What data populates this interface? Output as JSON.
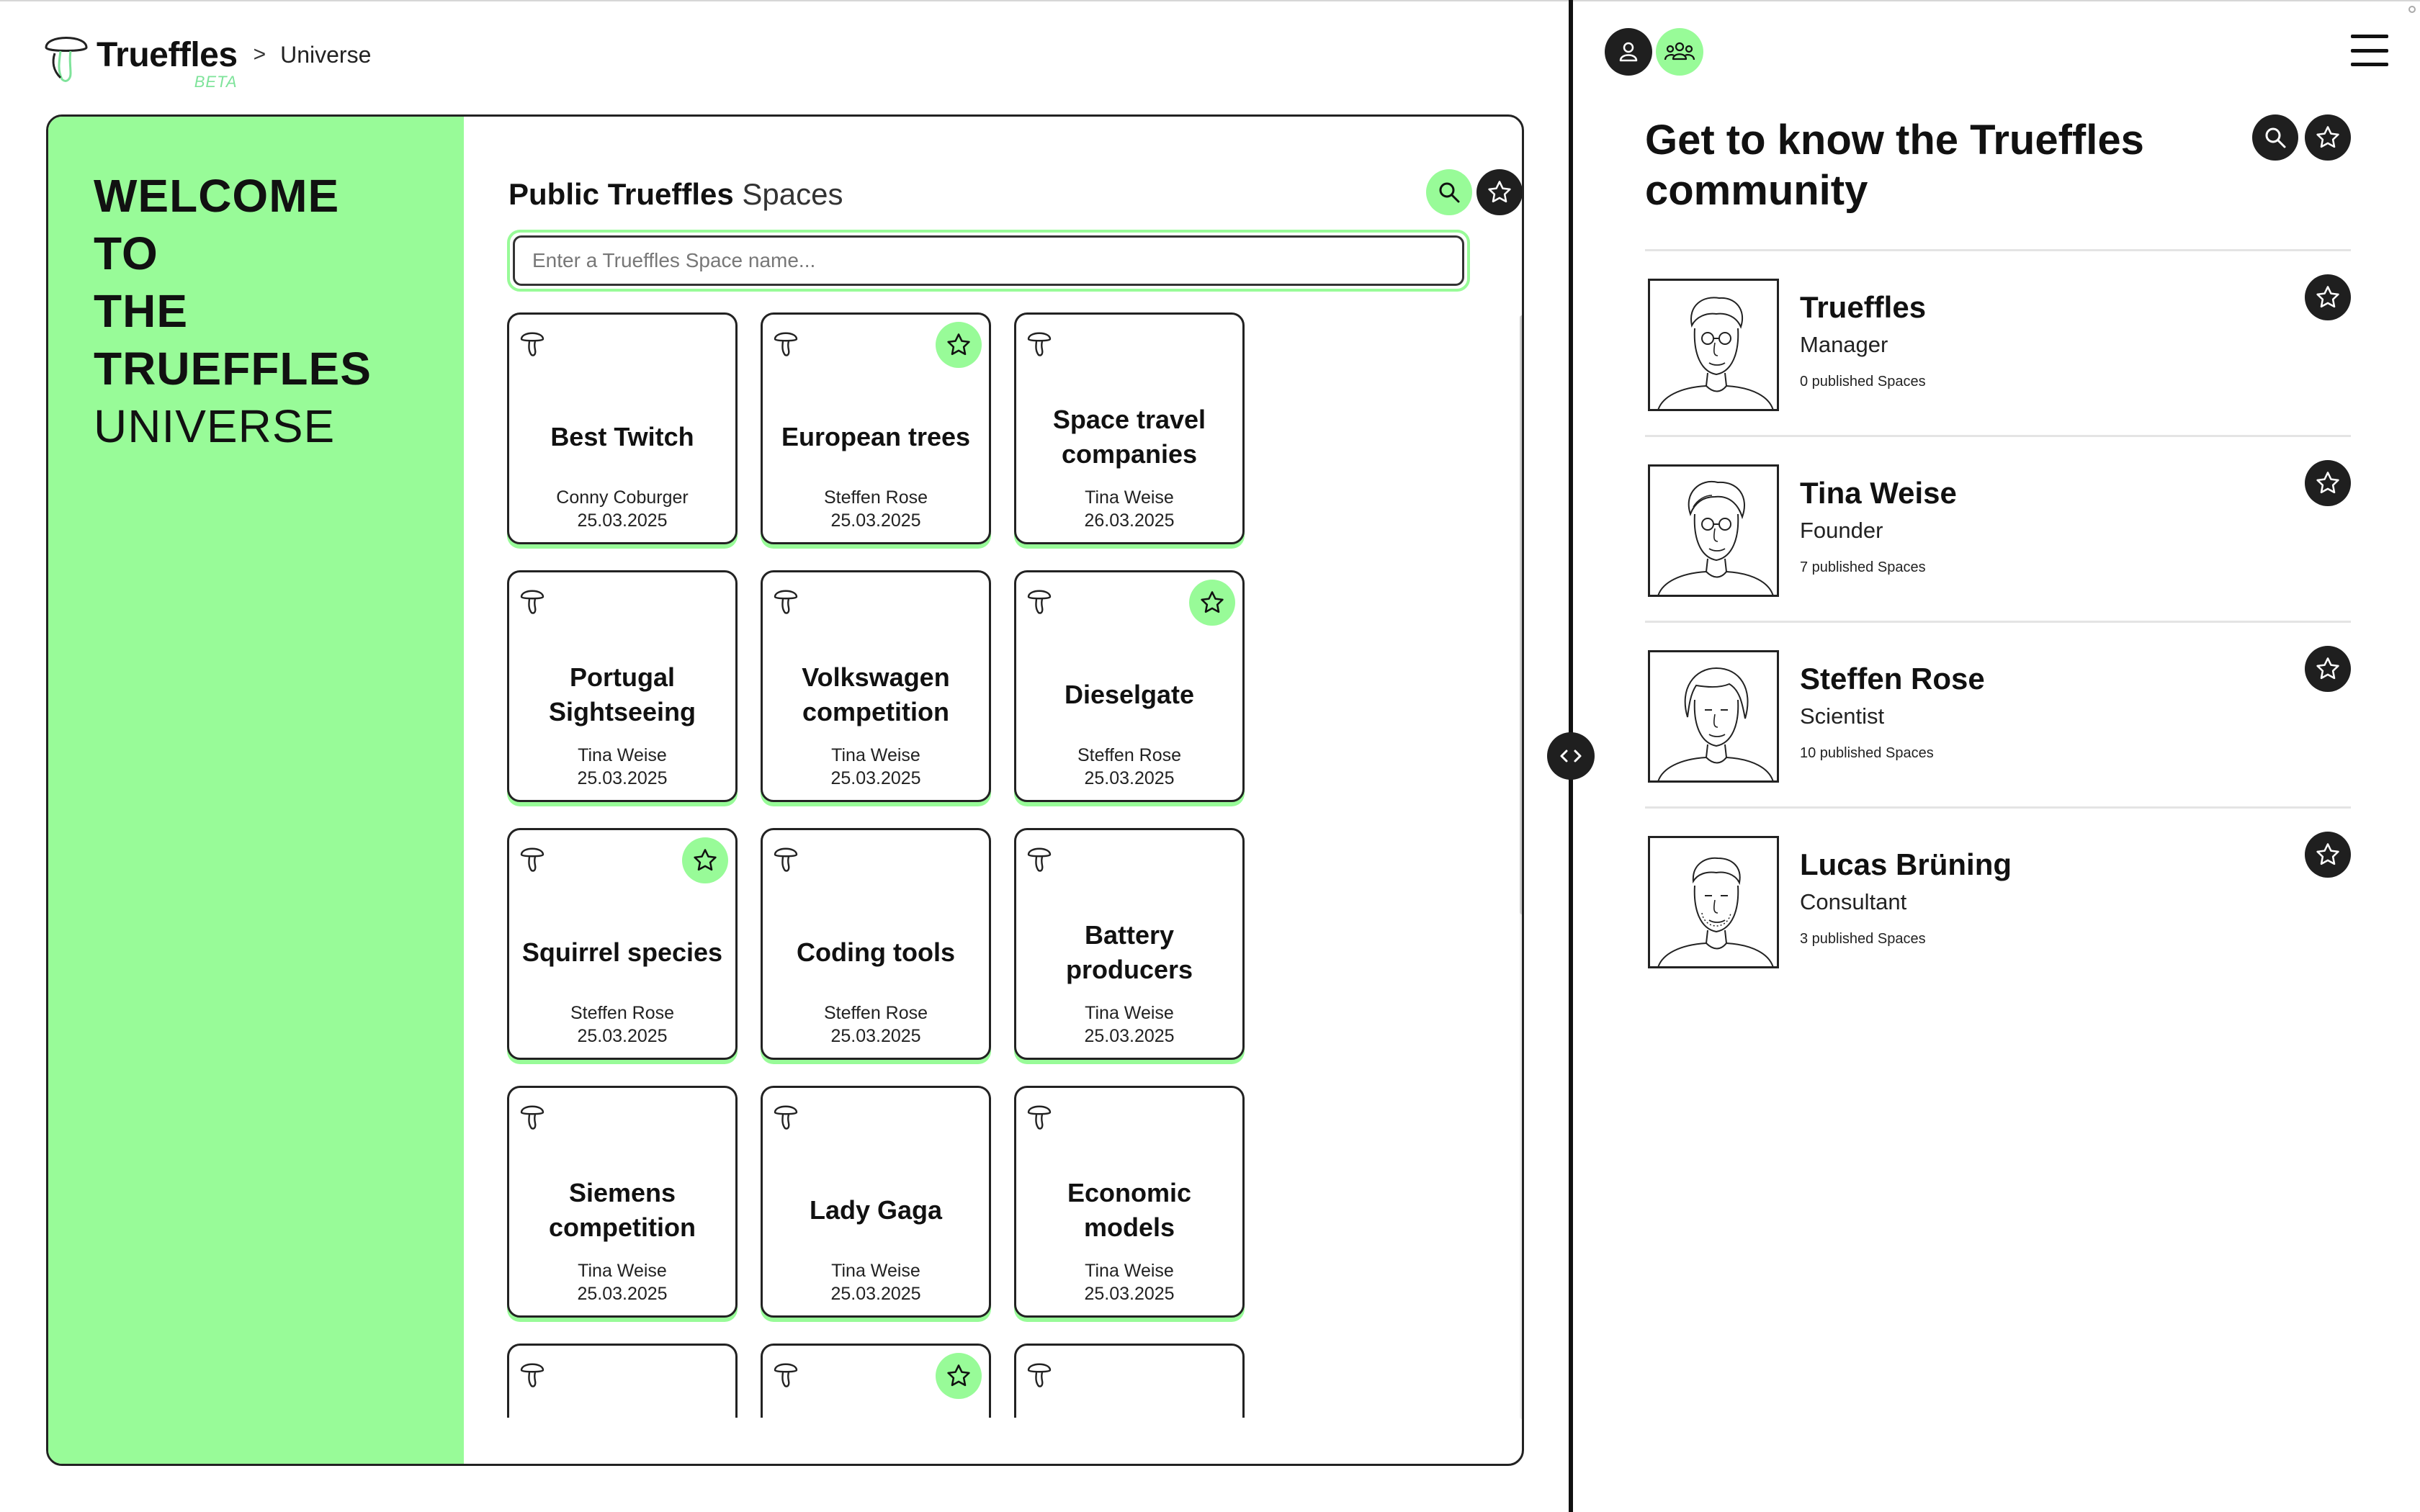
{
  "header": {
    "brand_name": "Trueffles",
    "brand_badge": "BETA",
    "breadcrumb_separator": ">",
    "breadcrumb_current": "Universe"
  },
  "welcome": {
    "lines": [
      "WELCOME",
      "TO",
      "THE",
      "TRUEFFLES",
      "UNIVERSE"
    ]
  },
  "spaces": {
    "title_bold": "Public Trueffles",
    "title_light": "Spaces",
    "search_placeholder": "Enter a Trueffles Space name...",
    "search_icon": "search-icon",
    "favorites_icon": "star-icon",
    "cards": [
      {
        "title": "Best Twitch",
        "author": "Conny Coburger",
        "date": "25.03.2025",
        "favorite": false
      },
      {
        "title": "European trees",
        "author": "Steffen Rose",
        "date": "25.03.2025",
        "favorite": true
      },
      {
        "title": "Space travel companies",
        "author": "Tina Weise",
        "date": "26.03.2025",
        "favorite": false
      },
      {
        "title": "Portugal Sightseeing",
        "author": "Tina Weise",
        "date": "25.03.2025",
        "favorite": false
      },
      {
        "title": "Volkswagen competition",
        "author": "Tina Weise",
        "date": "25.03.2025",
        "favorite": false
      },
      {
        "title": "Dieselgate",
        "author": "Steffen Rose",
        "date": "25.03.2025",
        "favorite": true
      },
      {
        "title": "Squirrel species",
        "author": "Steffen Rose",
        "date": "25.03.2025",
        "favorite": true
      },
      {
        "title": "Coding tools",
        "author": "Steffen Rose",
        "date": "25.03.2025",
        "favorite": false
      },
      {
        "title": "Battery producers",
        "author": "Tina Weise",
        "date": "25.03.2025",
        "favorite": false
      },
      {
        "title": "Siemens competition",
        "author": "Tina Weise",
        "date": "25.03.2025",
        "favorite": false
      },
      {
        "title": "Lady Gaga",
        "author": "Tina Weise",
        "date": "25.03.2025",
        "favorite": false
      },
      {
        "title": "Economic models",
        "author": "Tina Weise",
        "date": "25.03.2025",
        "favorite": false
      },
      {
        "title": "",
        "author": "",
        "date": "",
        "favorite": false
      },
      {
        "title": "",
        "author": "",
        "date": "",
        "favorite": true
      },
      {
        "title": "",
        "author": "",
        "date": "",
        "favorite": false
      }
    ]
  },
  "community": {
    "title": "Get to know the Trueffles community",
    "members": [
      {
        "name": "Trueffles",
        "role": "Manager",
        "spaces": "0 published Spaces"
      },
      {
        "name": "Tina Weise",
        "role": "Founder",
        "spaces": "7 published Spaces"
      },
      {
        "name": "Steffen Rose",
        "role": "Scientist",
        "spaces": "10 published Spaces"
      },
      {
        "name": "Lucas Brüning",
        "role": "Consultant",
        "spaces": "3 published Spaces"
      }
    ]
  },
  "colors": {
    "accent": "#98fb98",
    "dark": "#1f1f1f",
    "text": "#111111"
  },
  "icons": {
    "divider_handle": "chevron-left-right-icon",
    "profile": "user-icon",
    "community": "users-icon",
    "menu": "hamburger-menu-icon"
  }
}
